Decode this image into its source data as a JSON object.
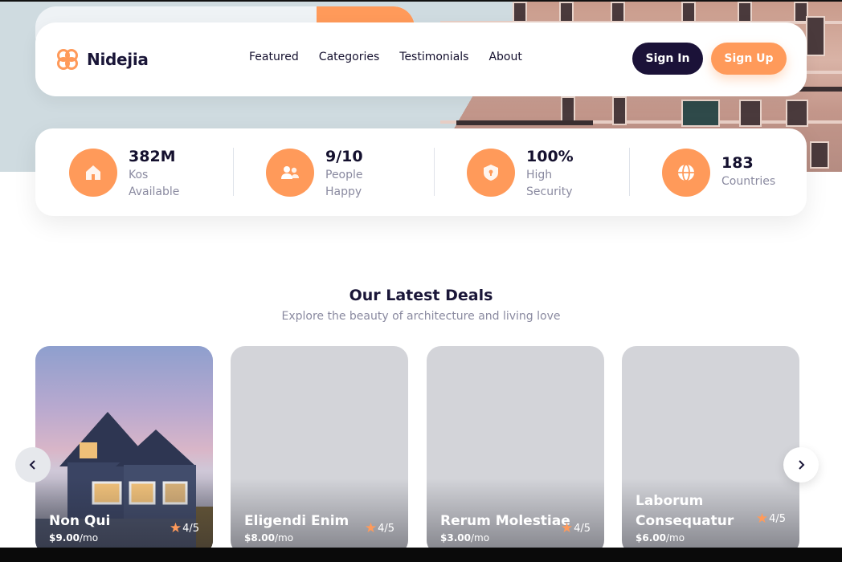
{
  "brand": {
    "name": "Nidejia",
    "accent": "#ff9a5a",
    "dark": "#1b1238"
  },
  "nav": {
    "links": [
      "Featured",
      "Categories",
      "Testimonials",
      "About"
    ],
    "sign_in": "Sign In",
    "sign_up": "Sign Up"
  },
  "stats": [
    {
      "value": "382M",
      "label_1": "Kos",
      "label_2": "Available",
      "icon": "home-icon"
    },
    {
      "value": "9/10",
      "label_1": "People",
      "label_2": "Happy",
      "icon": "people-icon"
    },
    {
      "value": "100%",
      "label_1": "High",
      "label_2": "Security",
      "icon": "shield-icon"
    },
    {
      "value": "183",
      "label_1": "Countries",
      "label_2": "",
      "icon": "globe-icon"
    }
  ],
  "section": {
    "title": "Our Latest Deals",
    "subtitle": "Explore the beauty of architecture and living love"
  },
  "deals": [
    {
      "title_1": "Non Qui",
      "title_2": "",
      "price": "$9.00",
      "unit": "/mo",
      "rating": "4/5"
    },
    {
      "title_1": "Eligendi Enim",
      "title_2": "",
      "price": "$8.00",
      "unit": "/mo",
      "rating": "4/5"
    },
    {
      "title_1": "Rerum Molestiae",
      "title_2": "",
      "price": "$3.00",
      "unit": "/mo",
      "rating": "4/5"
    },
    {
      "title_1": "Laborum",
      "title_2": "Consequatur",
      "price": "$6.00",
      "unit": "/mo",
      "rating": "4/5"
    }
  ]
}
